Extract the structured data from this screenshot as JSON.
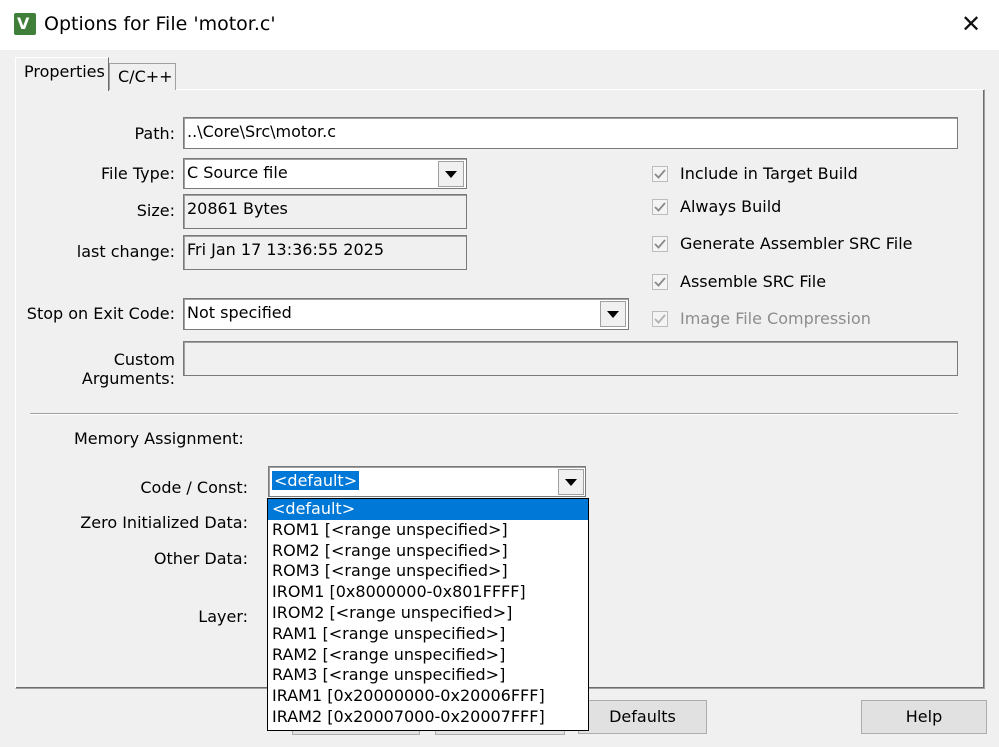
{
  "window": {
    "icon_text": "V",
    "title": "Options for File 'motor.c'"
  },
  "tabs": [
    {
      "label": "Properties"
    },
    {
      "label": "C/C++"
    }
  ],
  "fields": {
    "path_label": "Path:",
    "path_value": "..\\Core\\Src\\motor.c",
    "filetype_label": "File Type:",
    "filetype_value": "C Source file",
    "size_label": "Size:",
    "size_value": "20861 Bytes",
    "lastchange_label": "last change:",
    "lastchange_value": "Fri Jan 17 13:36:55 2025",
    "stop_label": "Stop on Exit Code:",
    "stop_value": "Not specified",
    "custom_label": "Custom Arguments:",
    "custom_value": ""
  },
  "checkboxes": [
    {
      "label": "Include in Target Build",
      "checked": true
    },
    {
      "label": "Always Build",
      "checked": true
    },
    {
      "label": "Generate Assembler SRC File",
      "checked": true
    },
    {
      "label": "Assemble SRC File",
      "checked": true
    },
    {
      "label": "Image File Compression",
      "checked": true,
      "disabled": true
    }
  ],
  "memory": {
    "section_label": "Memory Assignment:",
    "code_label": "Code / Const:",
    "code_value": "<default>",
    "zero_label": "Zero Initialized Data:",
    "other_label": "Other Data:",
    "layer_label": "Layer:"
  },
  "dropdown_options": [
    "<default>",
    "ROM1 [<range unspecified>]",
    "ROM2 [<range unspecified>]",
    "ROM3 [<range unspecified>]",
    "IROM1 [0x8000000-0x801FFFF]",
    "IROM2 [<range unspecified>]",
    "RAM1 [<range unspecified>]",
    "RAM2 [<range unspecified>]",
    "RAM3 [<range unspecified>]",
    "IRAM1 [0x20000000-0x20006FFF]",
    "IRAM2 [0x20007000-0x20007FFF]"
  ],
  "buttons": {
    "defaults": "Defaults",
    "help": "Help"
  }
}
